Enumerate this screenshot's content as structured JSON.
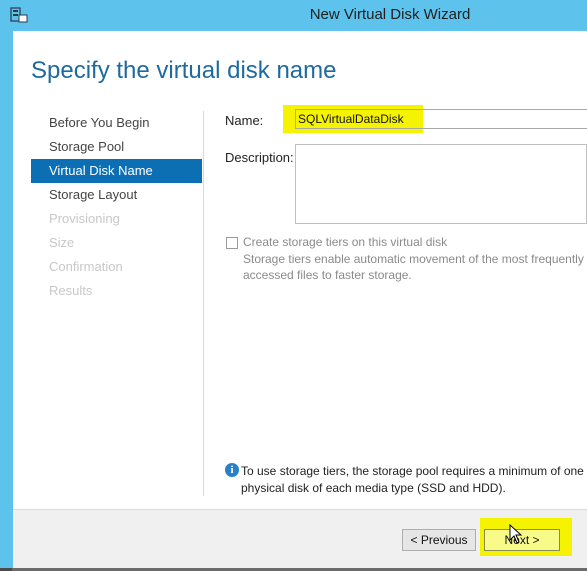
{
  "window": {
    "title": "New Virtual Disk Wizard"
  },
  "page": {
    "heading": "Specify the virtual disk name"
  },
  "nav": {
    "items": [
      {
        "label": "Before You Begin",
        "state": "normal"
      },
      {
        "label": "Storage Pool",
        "state": "normal"
      },
      {
        "label": "Virtual Disk Name",
        "state": "active"
      },
      {
        "label": "Storage Layout",
        "state": "normal"
      },
      {
        "label": "Provisioning",
        "state": "disabled"
      },
      {
        "label": "Size",
        "state": "disabled"
      },
      {
        "label": "Confirmation",
        "state": "disabled"
      },
      {
        "label": "Results",
        "state": "disabled"
      }
    ]
  },
  "form": {
    "name_label": "Name:",
    "name_value": "SQLVirtualDataDisk",
    "description_label": "Description:",
    "description_value": "",
    "tiers_checkbox_label": "Create storage tiers on this virtual disk",
    "tiers_checkbox_checked": false,
    "tiers_description": "Storage tiers enable automatic movement of the most frequently accessed files to faster storage."
  },
  "info": {
    "icon": "info-icon",
    "text": "To use storage tiers, the storage pool requires a minimum of one physical disk of each media type (SSD and HDD)."
  },
  "footer": {
    "previous_label": "< Previous",
    "next_label": "Next >"
  },
  "colors": {
    "title_bar": "#5ec3ec",
    "heading": "#1e6a9f",
    "nav_active": "#0d6fb3",
    "highlight": "#f6f300"
  }
}
